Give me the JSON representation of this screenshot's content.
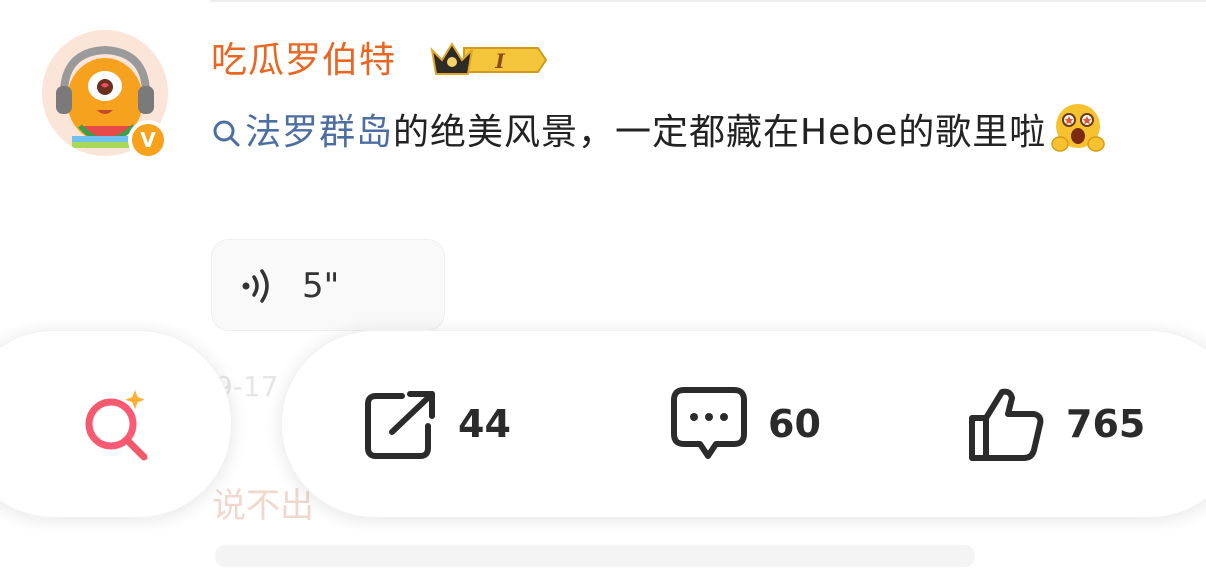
{
  "user": {
    "name": "吃瓜罗伯特",
    "badge_level": "I",
    "verified_mark": "V"
  },
  "post": {
    "topic": "法罗群岛",
    "text": "的绝美风景，一定都藏在Hebe的歌里啦",
    "emoji": "starstruck-emoji"
  },
  "voice": {
    "duration": "5\""
  },
  "background_text": {
    "timestamp_partial": "9-17",
    "faded_reply": "说不出"
  },
  "actions": {
    "share_count": "44",
    "comment_count": "60",
    "like_count": "765"
  },
  "colors": {
    "username": "#e86722",
    "topic": "#4d6ea0",
    "search_icon_gradient_start": "#f15a6b",
    "search_icon_gradient_end": "#ff8a4d",
    "verified_badge": "#f7a21a"
  }
}
